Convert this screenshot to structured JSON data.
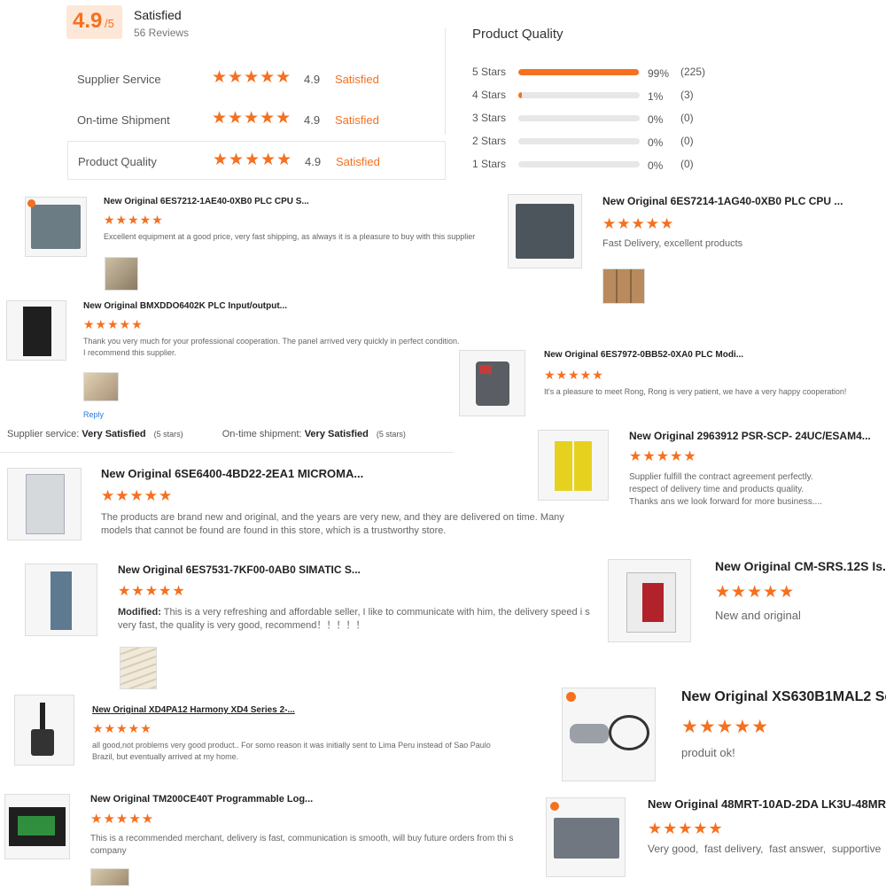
{
  "summary": {
    "score": "4.9",
    "score_suffix": "/5",
    "status": "Satisfied",
    "reviews": "56 Reviews",
    "metrics": [
      {
        "label": "Supplier Service",
        "value": "4.9",
        "status": "Satisfied"
      },
      {
        "label": "On-time Shipment",
        "value": "4.9",
        "status": "Satisfied"
      },
      {
        "label": "Product Quality",
        "value": "4.9",
        "status": "Satisfied"
      }
    ]
  },
  "quality": {
    "title": "Product Quality",
    "rows": [
      {
        "label": "5  Stars",
        "percent": "99%",
        "count": "(225)",
        "fill": 0.99
      },
      {
        "label": "4  Stars",
        "percent": "1%",
        "count": "(3)",
        "fill": 0.03
      },
      {
        "label": "3  Stars",
        "percent": "0%",
        "count": "(0)",
        "fill": 0
      },
      {
        "label": "2  Stars",
        "percent": "0%",
        "count": "(0)",
        "fill": 0
      },
      {
        "label": "1  Stars",
        "percent": "0%",
        "count": "(0)",
        "fill": 0
      }
    ]
  },
  "stars_glyph": "★★★★★",
  "reviews": [
    {
      "title": "New Original 6ES7212-1AE40-0XB0 PLC CPU S...",
      "text": "Excellent equipment at a good price, very fast shipping, as always it is a pleasure to buy with this supplier",
      "product_icon": "plc-cpu-icon"
    },
    {
      "title": "New Original 6ES7214-1AG40-0XB0 PLC CPU ...",
      "text": "Fast Delivery, excellent products",
      "product_icon": "plc-cpu-icon"
    },
    {
      "title": "New Original BMXDDO6402K PLC Input/output...",
      "text": "Thank you very much for your professional cooperation. The panel arrived very quickly in perfect condition.\nI recommend this supplier.",
      "reply": "Reply",
      "product_icon": "io-module-icon"
    },
    {
      "title": "New Original 6ES7972-0BB52-0XA0 PLC Modi...",
      "text": "It's a pleasure to meet Rong, Rong is very patient, we have a very happy cooperation!",
      "product_icon": "connector-icon"
    },
    {
      "title": "New Original 2963912 PSR-SCP- 24UC/ESAM4...",
      "text": "Supplier fulfill the contract agreement perfectly.\nrespect of delivery time and products quality.\nThanks ans we look forward for more business....",
      "product_icon": "safety-relay-icon"
    },
    {
      "title": "New Original 6SE6400-4BD22-2EA1 MICROMA...",
      "text": "The products are brand new and original, and the years are very new, and they are delivered on time. Many models that cannot be found are found in this store, which is a trustworthy store.",
      "product_icon": "drive-module-icon"
    },
    {
      "title": "New Original 6ES7531-7KF00-0AB0 SIMATIC S...",
      "modified_label": "Modified:",
      "text": " This is a very refreshing and affordable seller, I like to communicate with him, the delivery speed i s very fast, the quality is very good, recommend！！！！！",
      "product_icon": "simatic-module-icon"
    },
    {
      "title": "New Original CM-SRS.12S Is...",
      "text": "New and original",
      "product_icon": "relay-icon"
    },
    {
      "title": "New Original XD4PA12 Harmony XD4 Series 2-...",
      "text": "all good,not problems very good product.. For somo reason it was initially sent to Lima Peru instead of Sao Paulo Brazil, but eventually arrived at my home.",
      "product_icon": "joystick-icon"
    },
    {
      "title": "New Original XS630B1MAL2 Se",
      "text": "produit ok!",
      "product_icon": "proximity-sensor-icon"
    },
    {
      "title": "New Original TM200CE40T Programmable Log...",
      "text": "This is a recommended merchant, delivery is fast, communication is smooth, will buy future orders from thi s company",
      "product_icon": "plc-controller-icon"
    },
    {
      "title": "New Original 48MRT-10AD-2DA LK3U-48MR",
      "text": "Very good,  fast delivery,  fast answer,  supportive",
      "product_icon": "plc-controller-icon"
    }
  ],
  "service_line": {
    "supplier_label": "Supplier service:",
    "supplier_value": "Very Satisfied",
    "supplier_stars": "(5 stars)",
    "shipment_label": "On-time shipment:",
    "shipment_value": "Very Satisfied",
    "shipment_stars": "(5 stars)"
  },
  "colors": {
    "accent": "#f5701f",
    "score_bg": "#fde7d8"
  }
}
